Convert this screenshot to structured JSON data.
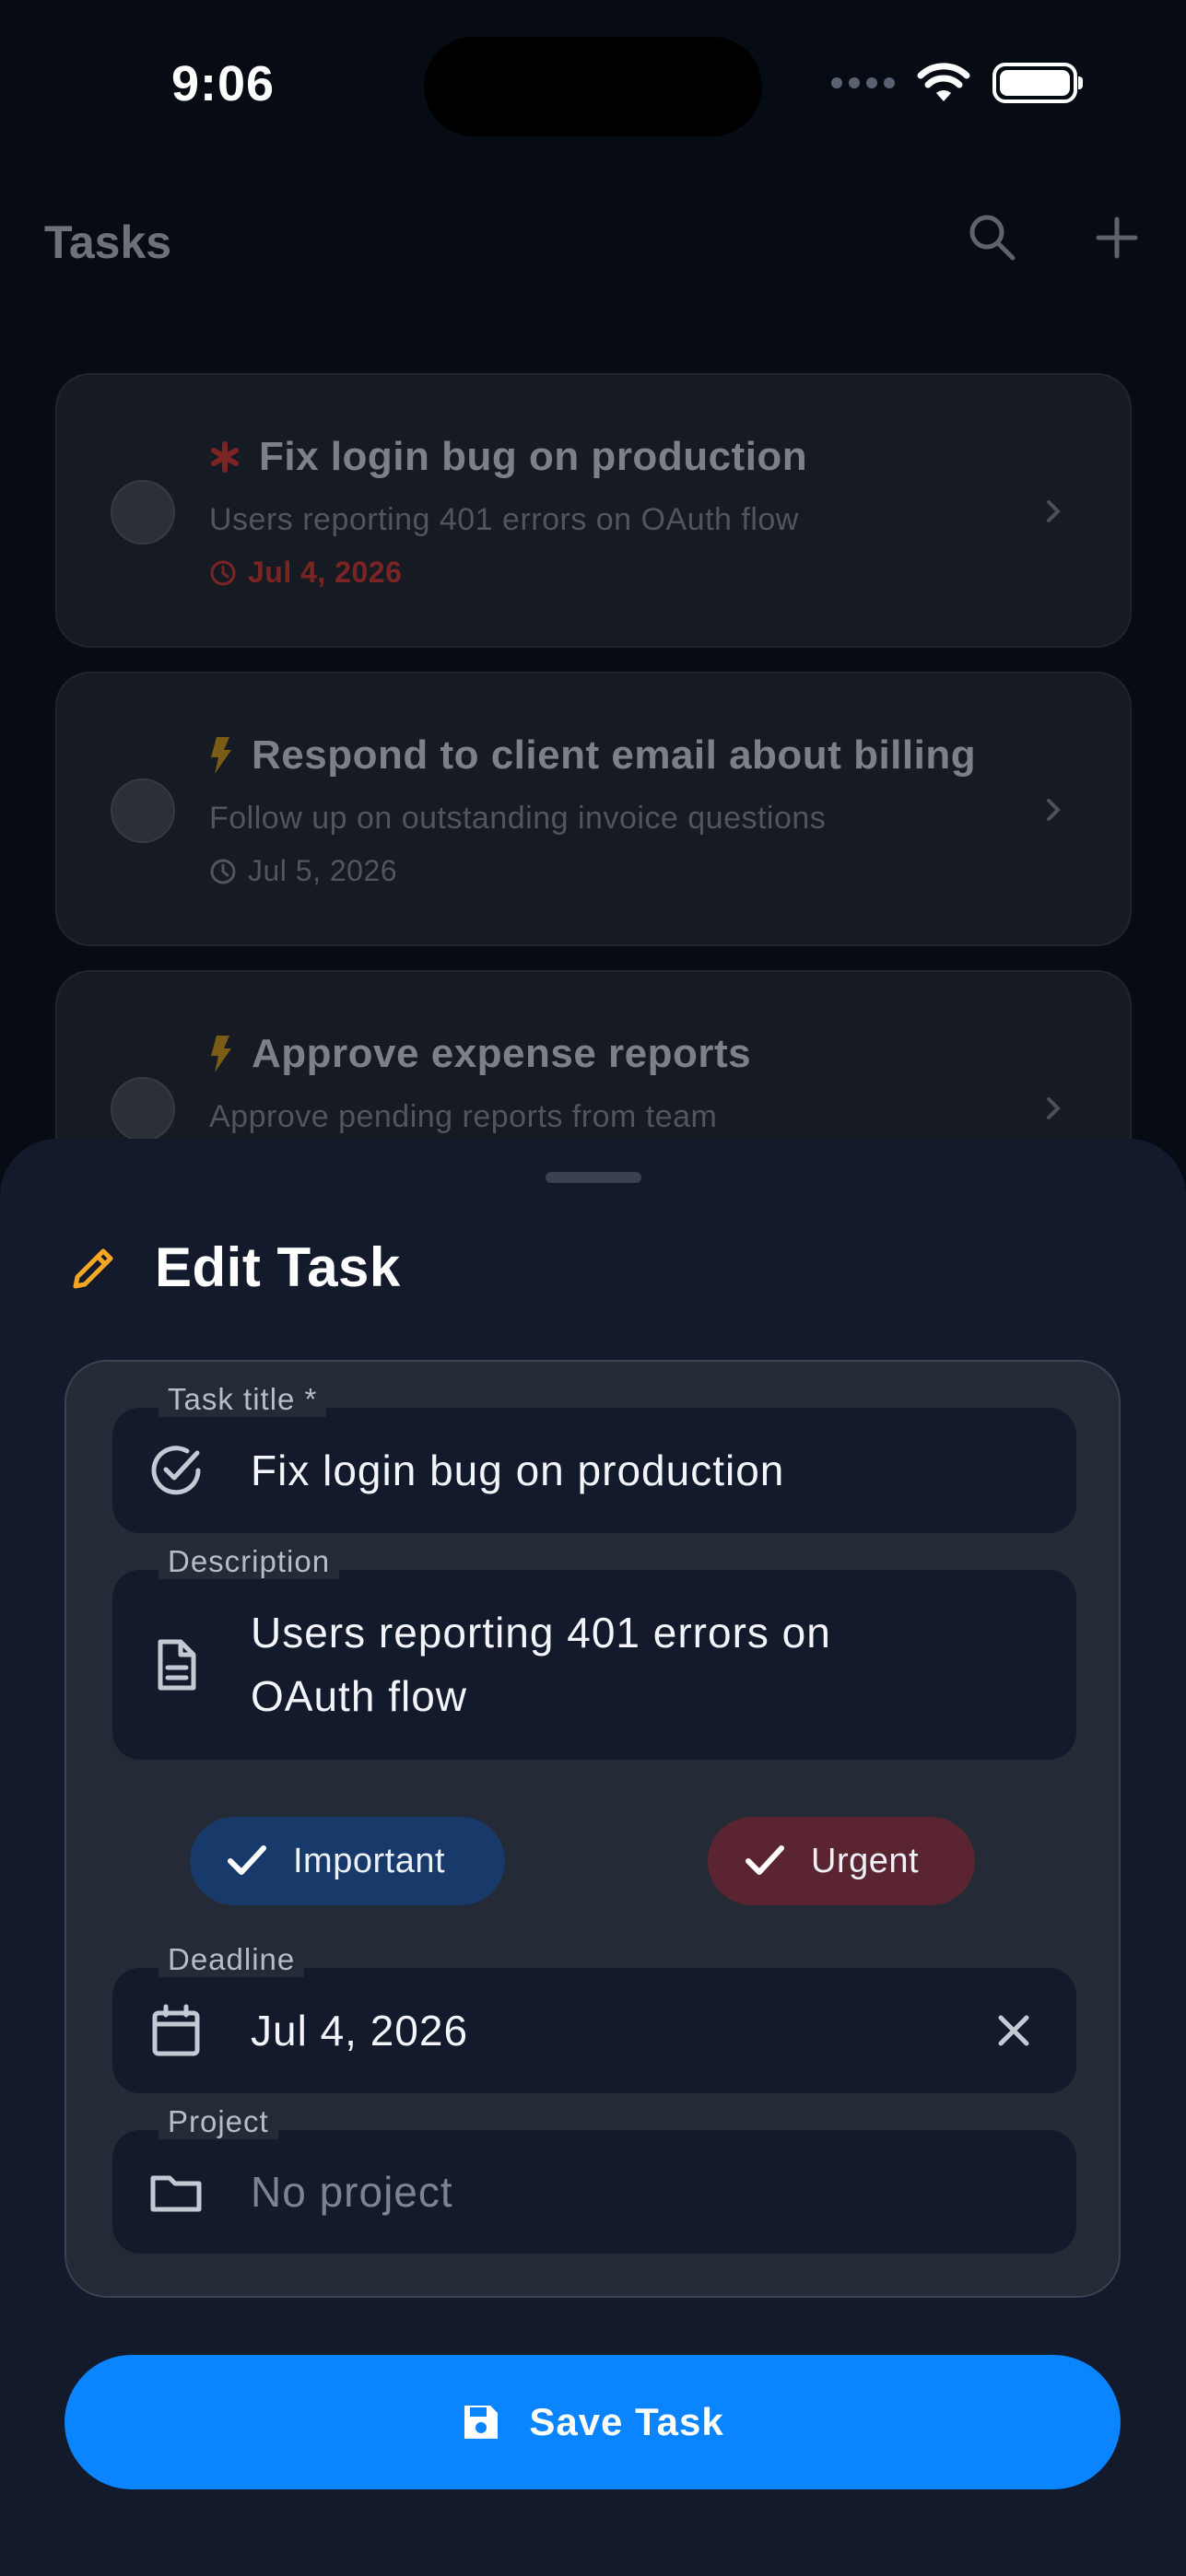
{
  "status_bar": {
    "time": "9:06"
  },
  "nav": {
    "title": "Tasks"
  },
  "tasks": [
    {
      "title": "Fix login bug on production",
      "description": "Users reporting 401 errors on OAuth flow",
      "date": "Jul 4, 2026",
      "priority_icon": "asterisk-icon"
    },
    {
      "title": "Respond to client email about billing",
      "description": "Follow up on outstanding invoice questions",
      "date": "Jul 5, 2026",
      "priority_icon": "bolt-icon"
    },
    {
      "title": "Approve expense reports",
      "description": "Approve pending reports from team",
      "priority_icon": "bolt-icon"
    }
  ],
  "sheet": {
    "title": "Edit Task",
    "fields": {
      "title": {
        "label": "Task title *",
        "value": "Fix login bug on production"
      },
      "description": {
        "label": "Description",
        "value_line1": "Users reporting 401 errors on",
        "value_line2": "OAuth flow"
      },
      "deadline": {
        "label": "Deadline",
        "value": "Jul 4, 2026"
      },
      "project": {
        "label": "Project",
        "placeholder": "No project"
      }
    },
    "chips": {
      "important": "Important",
      "urgent": "Urgent"
    },
    "save_label": "Save Task"
  },
  "colors": {
    "accent": "#0a84ff",
    "important_chip": "#173a6a",
    "urgent_chip": "#5a2530",
    "edit_icon": "#f5a623",
    "urgent_red": "#7c2424"
  }
}
